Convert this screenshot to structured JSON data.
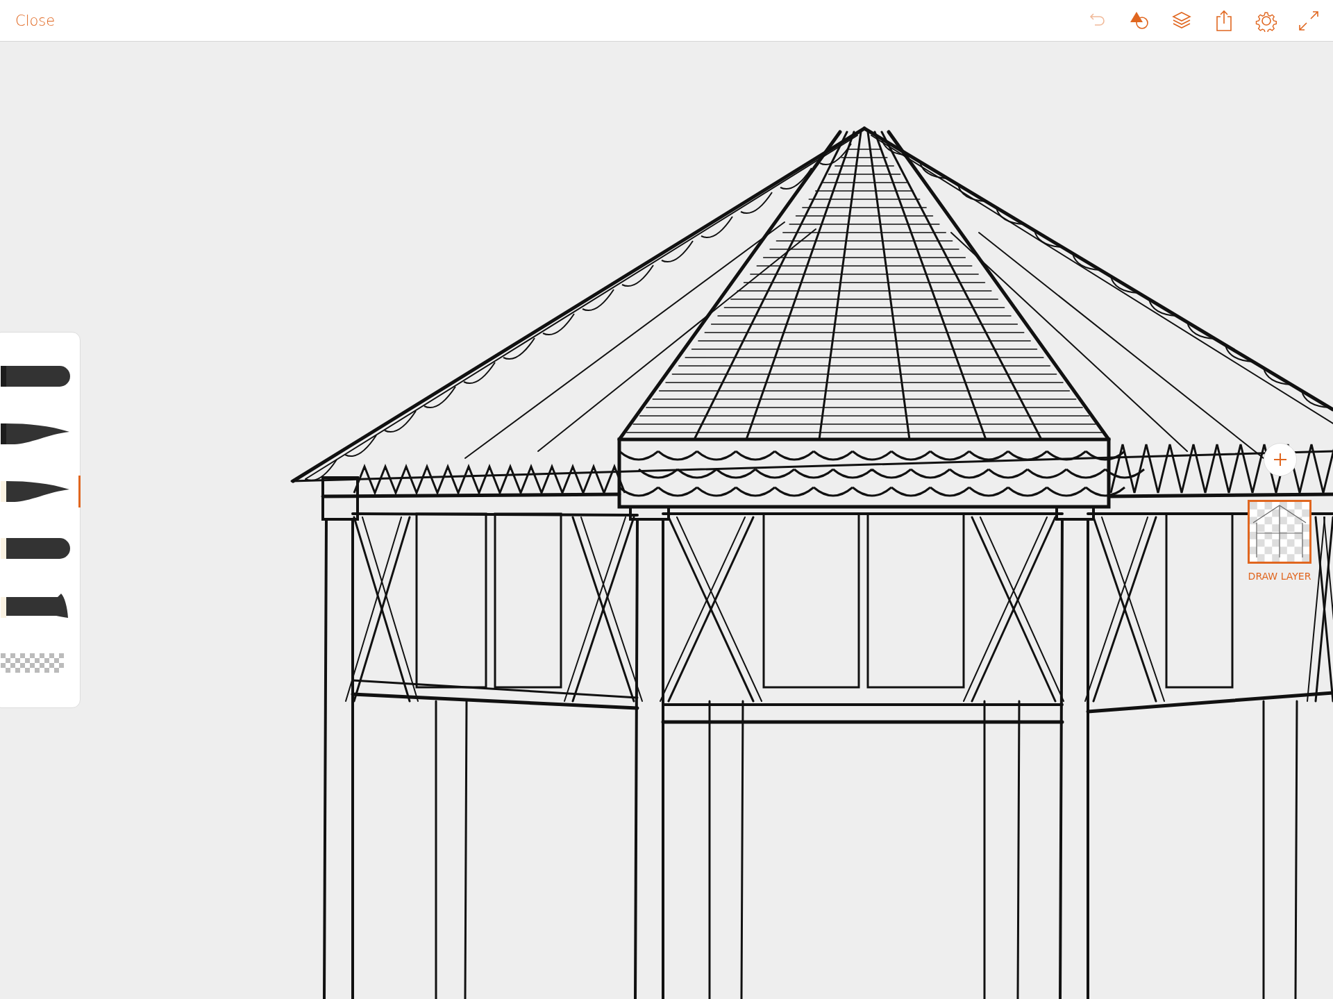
{
  "top_bar": {
    "close": "Close",
    "tools": [
      {
        "kind": "undo",
        "disabled": true
      },
      {
        "kind": "shapes",
        "disabled": false
      },
      {
        "kind": "layers",
        "disabled": false
      },
      {
        "kind": "share",
        "disabled": false
      },
      {
        "kind": "settings",
        "disabled": false
      },
      {
        "kind": "fullscreen",
        "disabled": false
      }
    ]
  },
  "brushes": [
    {
      "kind": "round",
      "selected": false
    },
    {
      "kind": "taper",
      "selected": false
    },
    {
      "kind": "taper",
      "selected": true
    },
    {
      "kind": "round",
      "selected": false
    },
    {
      "kind": "marker",
      "selected": false
    },
    {
      "kind": "eraser",
      "selected": false
    }
  ],
  "layers": [
    {
      "label": "DRAW LAYER",
      "selected": true
    }
  ]
}
